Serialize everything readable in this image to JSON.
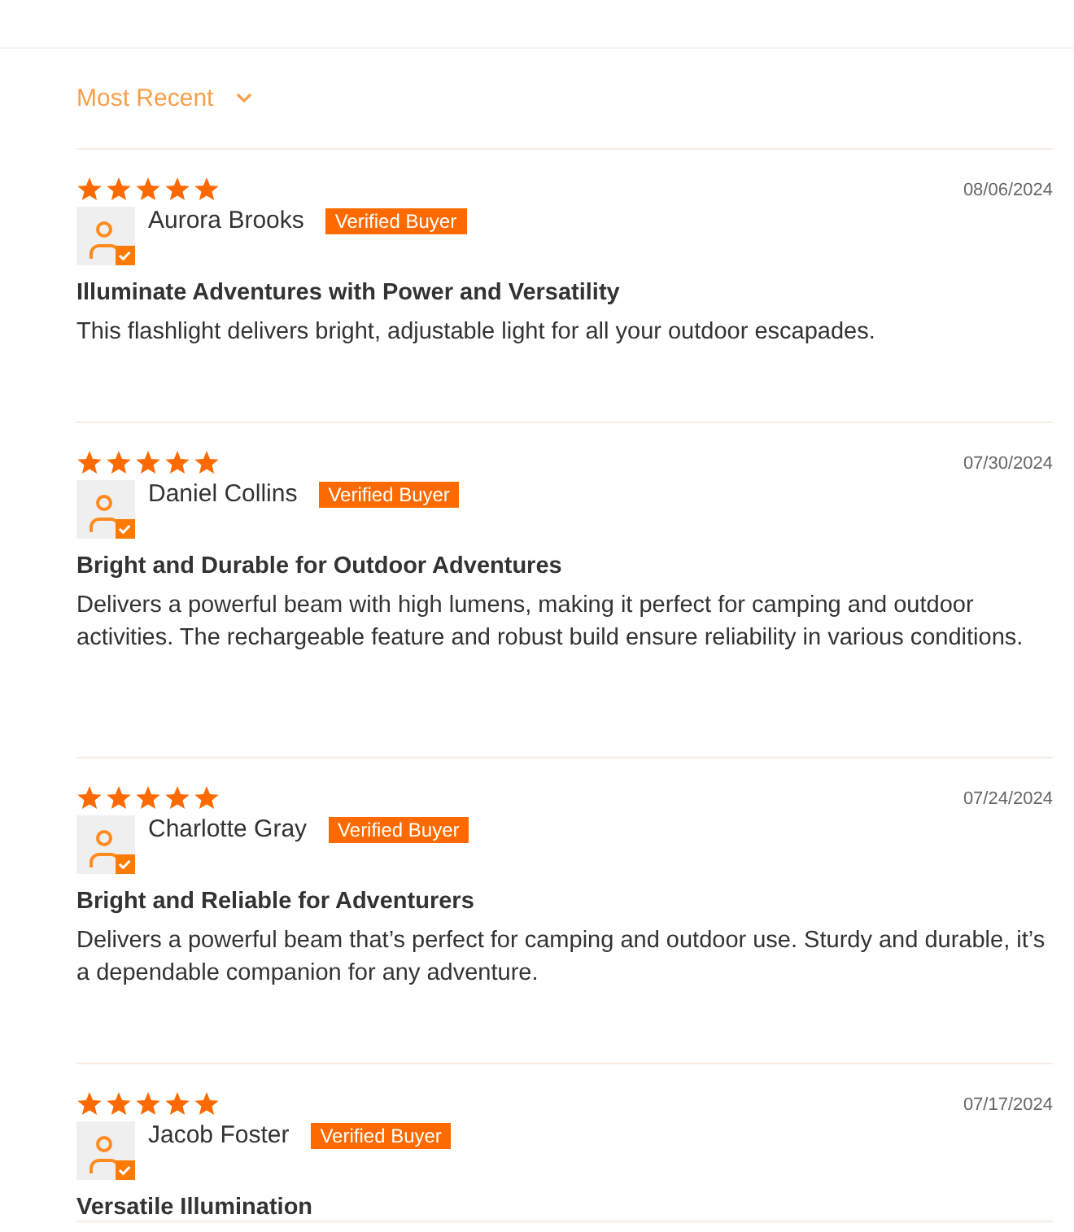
{
  "sort": {
    "label": "Most Recent"
  },
  "reviews": [
    {
      "stars": 5,
      "date": "08/06/2024",
      "name": "Aurora Brooks",
      "badge": "Verified Buyer",
      "title": "Illuminate Adventures with Power and Versatility",
      "body": "This flashlight delivers bright, adjustable light for all your outdoor escapades."
    },
    {
      "stars": 5,
      "date": "07/30/2024",
      "name": "Daniel Collins",
      "badge": "Verified Buyer",
      "title": "Bright and Durable for Outdoor Adventures",
      "body": "Delivers a powerful beam with high lumens, making it perfect for camping and outdoor activities. The rechargeable feature and robust build ensure reliability in various conditions."
    },
    {
      "stars": 5,
      "date": "07/24/2024",
      "name": "Charlotte Gray",
      "badge": "Verified Buyer",
      "title": "Bright and Reliable for Adventurers",
      "body": "Delivers a powerful beam that’s perfect for camping and outdoor use. Sturdy and durable, it’s a dependable companion for any adventure."
    },
    {
      "stars": 5,
      "date": "07/17/2024",
      "name": "Jacob Foster",
      "badge": "Verified Buyer",
      "title": "Versatile Illumination"
    }
  ]
}
